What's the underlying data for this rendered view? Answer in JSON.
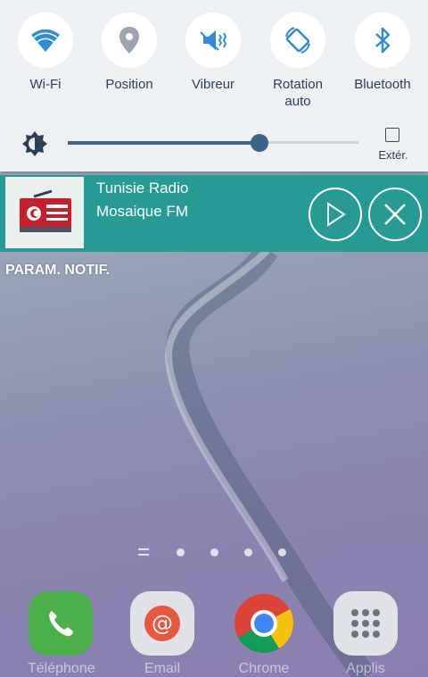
{
  "quick_settings": {
    "tiles": [
      {
        "label": "Wi-Fi",
        "icon": "wifi-icon"
      },
      {
        "label": "Position",
        "icon": "location-icon"
      },
      {
        "label": "Vibreur",
        "icon": "vibrate-icon"
      },
      {
        "label": "Rotation\nauto",
        "icon": "auto-rotate-icon"
      },
      {
        "label": "Bluetooth",
        "icon": "bluetooth-icon"
      }
    ],
    "brightness": {
      "level_percent": 66,
      "icon": "brightness-icon"
    },
    "outdoor_mode_label": "Extér.",
    "outdoor_mode_checked": false
  },
  "notification": {
    "title": "Tunisie Radio",
    "subtitle": "Mosaique FM",
    "app_icon": "radio-icon",
    "play_icon": "play-icon",
    "close_icon": "close-icon",
    "color": "#289a96"
  },
  "notification_settings_label": "PARAM. NOTIF.",
  "home": {
    "page_indicator_count": 4,
    "dock": [
      {
        "label": "Téléphone",
        "icon": "phone-icon"
      },
      {
        "label": "Email",
        "icon": "email-icon"
      },
      {
        "label": "Chrome",
        "icon": "chrome-icon"
      },
      {
        "label": "Applis",
        "icon": "apps-grid-icon"
      }
    ]
  },
  "colors": {
    "accent": "#3d6287",
    "tile_icon": "#2f8cd9"
  }
}
